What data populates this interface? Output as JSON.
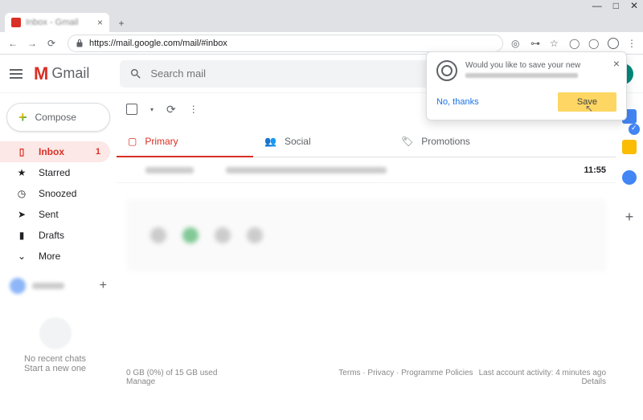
{
  "browser": {
    "url": "https://mail.google.com/mail/#inbox"
  },
  "app": {
    "name": "Gmail",
    "search_placeholder": "Search mail",
    "compose_label": "Compose"
  },
  "sidebar": {
    "items": [
      {
        "label": "Inbox",
        "count": "1",
        "icon": "inbox",
        "active": true
      },
      {
        "label": "Starred",
        "icon": "star"
      },
      {
        "label": "Snoozed",
        "icon": "clock"
      },
      {
        "label": "Sent",
        "icon": "send"
      },
      {
        "label": "Drafts",
        "icon": "file"
      },
      {
        "label": "More",
        "icon": "chevron-down"
      }
    ]
  },
  "hangouts": {
    "line1": "No recent chats",
    "line2": "Start a new one"
  },
  "category_tabs": [
    {
      "label": "Primary",
      "active": true
    },
    {
      "label": "Social"
    },
    {
      "label": "Promotions"
    }
  ],
  "mail": {
    "row_time": "11:55"
  },
  "footer": {
    "storage_line1": "0 GB (0%) of 15 GB used",
    "storage_line2": "Manage",
    "links": "Terms · Privacy · Programme Policies",
    "activity_line1": "Last account activity: 4 minutes ago",
    "activity_line2": "Details"
  },
  "save_popup": {
    "prompt": "Would you like to save your new",
    "no_thanks": "No, thanks",
    "save": "Save"
  }
}
